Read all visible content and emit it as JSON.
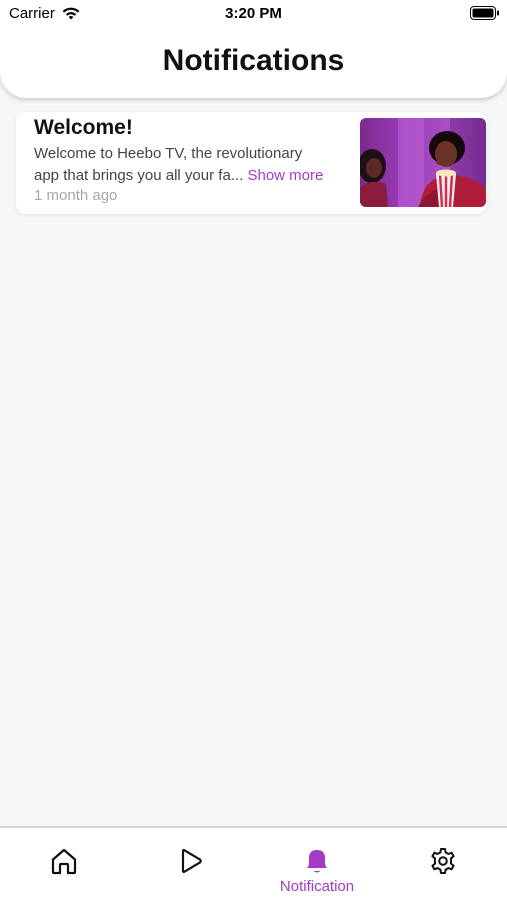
{
  "status_bar": {
    "carrier": "Carrier",
    "time": "3:20 PM"
  },
  "header": {
    "title": "Notifications"
  },
  "notifications": [
    {
      "title": "Welcome!",
      "body_line1": "Welcome to Heebo TV, the revolutionary",
      "body_line2": "app that brings you all your fa...",
      "show_more": "Show more",
      "time": "1 month ago"
    }
  ],
  "tabbar": {
    "active_tab": "Notification",
    "notification_label": "Notification",
    "accent_color": "#a43bc4",
    "icons": [
      "home-icon",
      "play-icon",
      "bell-icon",
      "gear-icon"
    ]
  }
}
